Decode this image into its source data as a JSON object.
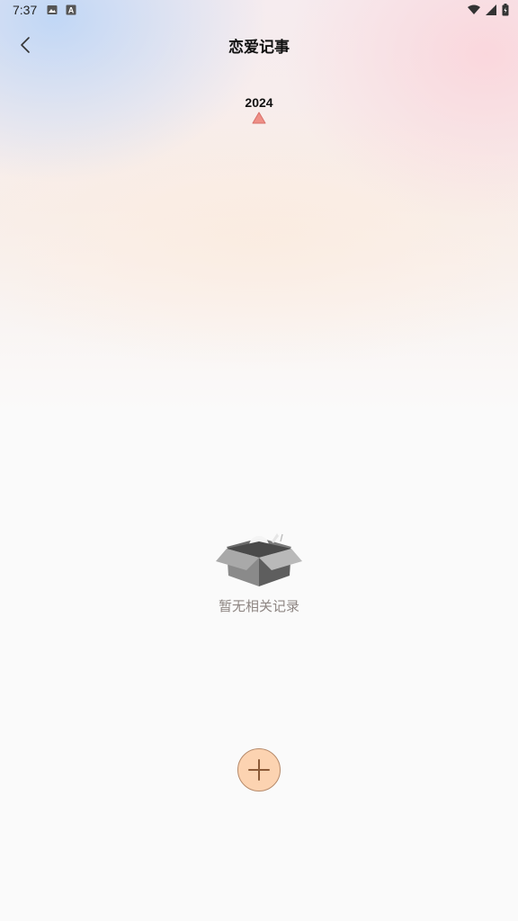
{
  "status_bar": {
    "time": "7:37",
    "icons": [
      "image-icon",
      "a-icon",
      "wifi-icon",
      "signal-icon",
      "battery-icon"
    ]
  },
  "header": {
    "title": "恋爱记事",
    "back_icon": "chevron-left-icon"
  },
  "year_selector": {
    "year": "2024",
    "indicator_icon": "triangle-up-icon",
    "indicator_color": "#ee8f86"
  },
  "empty_state": {
    "icon": "empty-box-icon",
    "text": "暂无相关记录"
  },
  "add_button": {
    "icon": "plus-icon",
    "background": "#fcd3b1"
  },
  "colors": {
    "accent": "#fcd3b1",
    "muted_text": "#8e8683"
  }
}
